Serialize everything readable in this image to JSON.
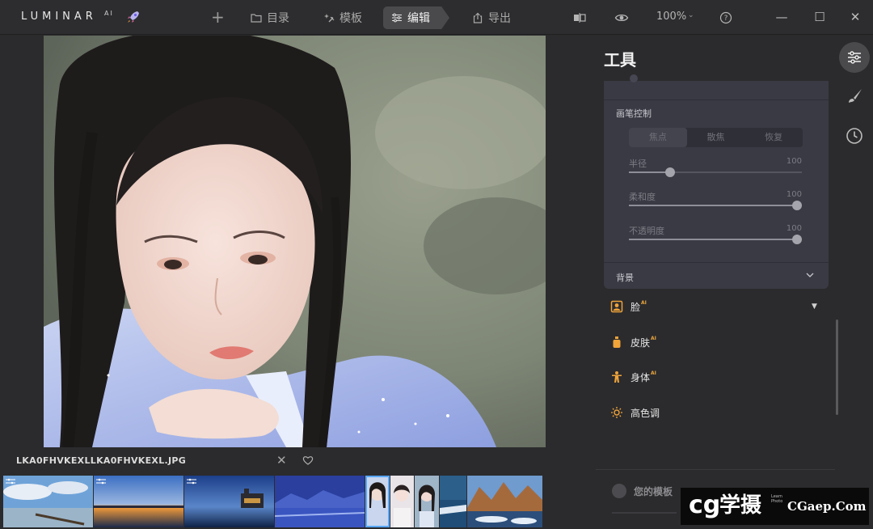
{
  "app": {
    "logo": "LUMINAR",
    "logo_sup": "AI"
  },
  "nav": {
    "catalog": "目录",
    "templates": "模板",
    "edit": "编辑",
    "export": "导出",
    "zoom": "100%"
  },
  "photo": {
    "filename": "LKA0FHVKEXLLKA0FHVKEXL.JPG"
  },
  "filmstrip": {
    "thumbnails": [
      {
        "subject": "pier-sky",
        "edited": true,
        "selected": false
      },
      {
        "subject": "sunset-lake",
        "edited": true,
        "selected": false
      },
      {
        "subject": "castle-night",
        "edited": true,
        "selected": false
      },
      {
        "subject": "blue-mountains",
        "edited": false,
        "selected": false
      },
      {
        "subject": "portrait-girl",
        "edited": false,
        "selected": true
      },
      {
        "subject": "portrait-girl-2",
        "edited": false,
        "selected": false
      },
      {
        "subject": "portrait-girl-3",
        "edited": false,
        "selected": false
      },
      {
        "subject": "winter-river",
        "edited": false,
        "selected": false
      },
      {
        "subject": "snowy-cliffs",
        "edited": false,
        "selected": false
      }
    ]
  },
  "panel": {
    "title": "工具",
    "brush_control": {
      "label": "画笔控制",
      "modes": [
        "焦点",
        "散焦",
        "恢复"
      ],
      "active_mode": "焦点",
      "sliders": [
        {
          "label": "半径",
          "value": "100",
          "position": 0.24
        },
        {
          "label": "柔和度",
          "value": "100",
          "position": 0.97
        },
        {
          "label": "不透明度",
          "value": "100",
          "position": 0.97
        }
      ],
      "background_label": "背景"
    },
    "tools": [
      {
        "name": "脸",
        "ai": "AI",
        "icon": "portrait-icon"
      },
      {
        "name": "皮肤",
        "ai": "AI",
        "icon": "bottle-icon"
      },
      {
        "name": "身体",
        "ai": "AI",
        "icon": "body-icon"
      },
      {
        "name": "高色调",
        "ai": "",
        "icon": "sun-icon"
      }
    ],
    "my_templates": "您的模板"
  },
  "watermark": {
    "brand": "学摄",
    "url": "CGaep.Com"
  },
  "colors": {
    "accent": "#5aa7ff",
    "ai_badge": "#e9a53f",
    "panel_bg": "#2b2b2d",
    "card_bg": "#3a3a44"
  }
}
